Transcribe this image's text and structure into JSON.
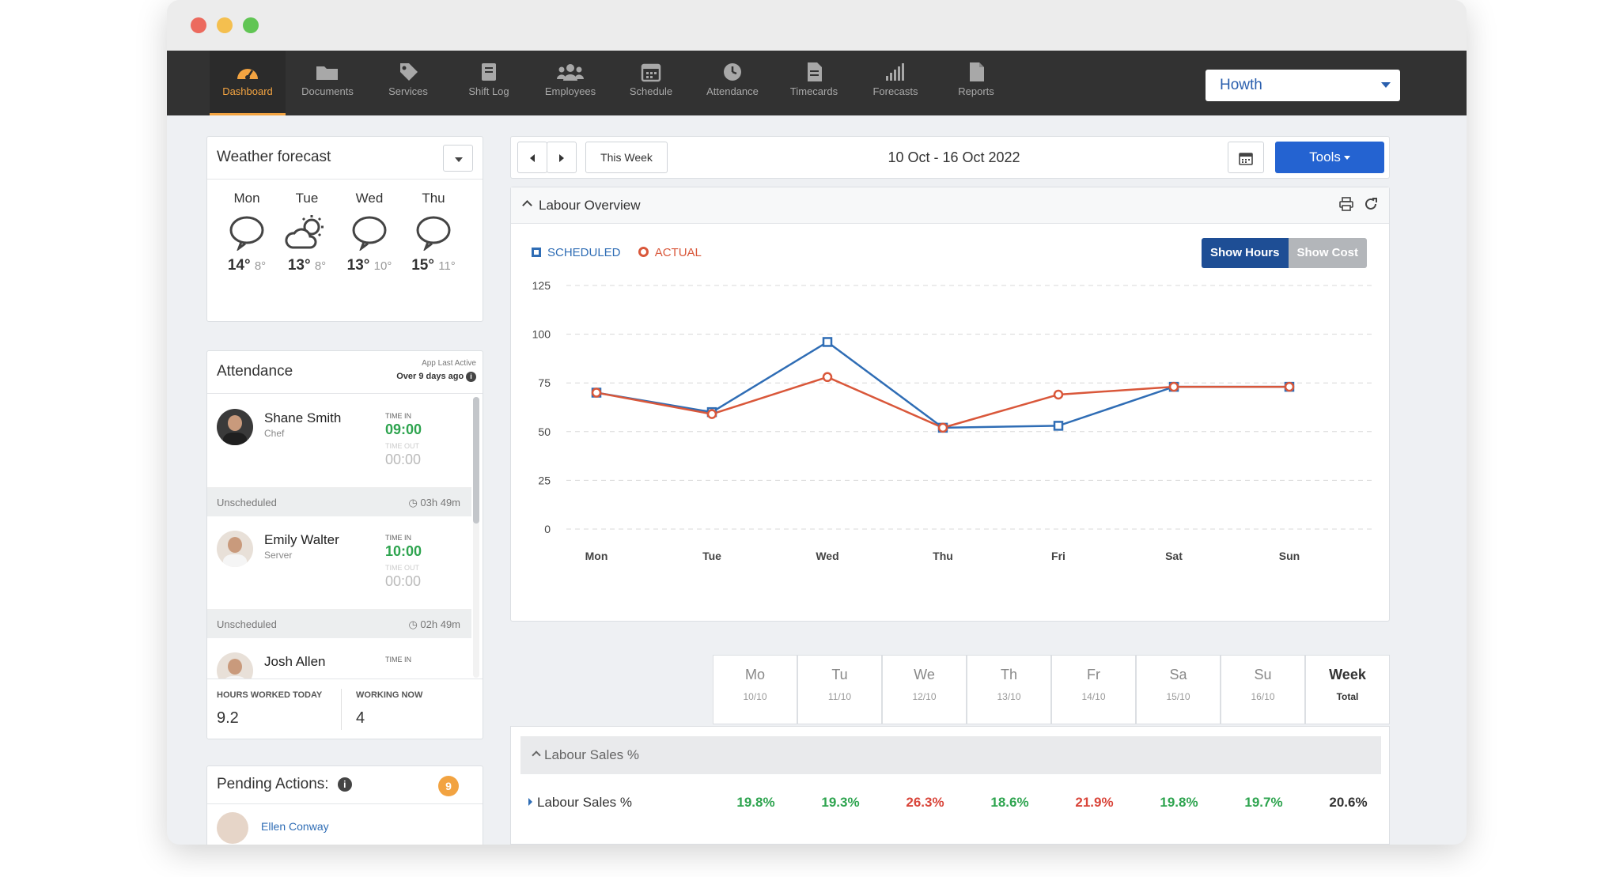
{
  "nav": {
    "items": [
      {
        "label": "Dashboard",
        "icon": "dashboard-gauge-icon",
        "active": true
      },
      {
        "label": "Documents",
        "icon": "folder-icon"
      },
      {
        "label": "Services",
        "icon": "tag-icon"
      },
      {
        "label": "Shift Log",
        "icon": "book-icon"
      },
      {
        "label": "Employees",
        "icon": "people-icon"
      },
      {
        "label": "Schedule",
        "icon": "calendar-icon"
      },
      {
        "label": "Attendance",
        "icon": "clock-icon"
      },
      {
        "label": "Timecards",
        "icon": "document-icon"
      },
      {
        "label": "Forecasts",
        "icon": "bar-chart-icon"
      },
      {
        "label": "Reports",
        "icon": "file-icon"
      }
    ],
    "location": "Howth"
  },
  "weather": {
    "title": "Weather forecast",
    "days": [
      {
        "day": "Mon",
        "high": "14°",
        "low": "8°",
        "icon": "cloud-icon"
      },
      {
        "day": "Tue",
        "high": "13°",
        "low": "8°",
        "icon": "sun-cloud-icon"
      },
      {
        "day": "Wed",
        "high": "13°",
        "low": "10°",
        "icon": "cloud-icon"
      },
      {
        "day": "Thu",
        "high": "15°",
        "low": "11°",
        "icon": "cloud-icon"
      }
    ]
  },
  "attendance": {
    "title": "Attendance",
    "last_active_label": "App Last Active",
    "last_active_value": "Over 9 days ago",
    "people": [
      {
        "name": "Shane Smith",
        "role": "Chef",
        "time_in_label": "TIME IN",
        "time_in": "09:00",
        "time_out_label": "TIME OUT",
        "time_out": "00:00",
        "status": "Unscheduled",
        "duration": "03h 49m"
      },
      {
        "name": "Emily Walter",
        "role": "Server",
        "time_in_label": "TIME IN",
        "time_in": "10:00",
        "time_out_label": "TIME OUT",
        "time_out": "00:00",
        "status": "Unscheduled",
        "duration": "02h 49m"
      },
      {
        "name": "Josh Allen",
        "time_in_label": "TIME IN"
      }
    ],
    "hours_worked_label": "HOURS WORKED TODAY",
    "hours_worked": "9.2",
    "working_now_label": "WORKING NOW",
    "working_now": "4"
  },
  "pending": {
    "title": "Pending Actions:",
    "count": "9",
    "first_person": "Ellen Conway"
  },
  "toolbar": {
    "this_week": "This Week",
    "date_range": "10 Oct - 16 Oct 2022",
    "tools": "Tools"
  },
  "labour": {
    "title": "Labour Overview",
    "legend_scheduled": "SCHEDULED",
    "legend_actual": "ACTUAL",
    "show_hours": "Show Hours",
    "show_cost": "Show Cost"
  },
  "chart_data": {
    "type": "line",
    "categories": [
      "Mon",
      "Tue",
      "Wed",
      "Thu",
      "Fri",
      "Sat",
      "Sun"
    ],
    "ylim": [
      0,
      125
    ],
    "yticks": [
      0,
      25,
      50,
      75,
      100,
      125
    ],
    "grid": true,
    "legend_position": "top-left",
    "series": [
      {
        "name": "SCHEDULED",
        "color": "#2f6db5",
        "marker": "square",
        "values": [
          70,
          60,
          96,
          52,
          53,
          73,
          73
        ]
      },
      {
        "name": "ACTUAL",
        "color": "#d9573a",
        "marker": "circle",
        "values": [
          70,
          59,
          78,
          52,
          69,
          73,
          73
        ]
      }
    ]
  },
  "days_header": [
    {
      "day": "Mo",
      "date": "10/10"
    },
    {
      "day": "Tu",
      "date": "11/10"
    },
    {
      "day": "We",
      "date": "12/10"
    },
    {
      "day": "Th",
      "date": "13/10"
    },
    {
      "day": "Fr",
      "date": "14/10"
    },
    {
      "day": "Sa",
      "date": "15/10"
    },
    {
      "day": "Su",
      "date": "16/10"
    },
    {
      "day": "Week",
      "date": "Total"
    }
  ],
  "labour_sales": {
    "section_title": "Labour Sales %",
    "row_label": "Labour Sales %",
    "values": [
      {
        "v": "19.8%",
        "color": "green"
      },
      {
        "v": "19.3%",
        "color": "green"
      },
      {
        "v": "26.3%",
        "color": "red"
      },
      {
        "v": "18.6%",
        "color": "green"
      },
      {
        "v": "21.9%",
        "color": "red"
      },
      {
        "v": "19.8%",
        "color": "green"
      },
      {
        "v": "19.7%",
        "color": "green"
      },
      {
        "v": "20.6%",
        "color": "dark"
      }
    ]
  }
}
